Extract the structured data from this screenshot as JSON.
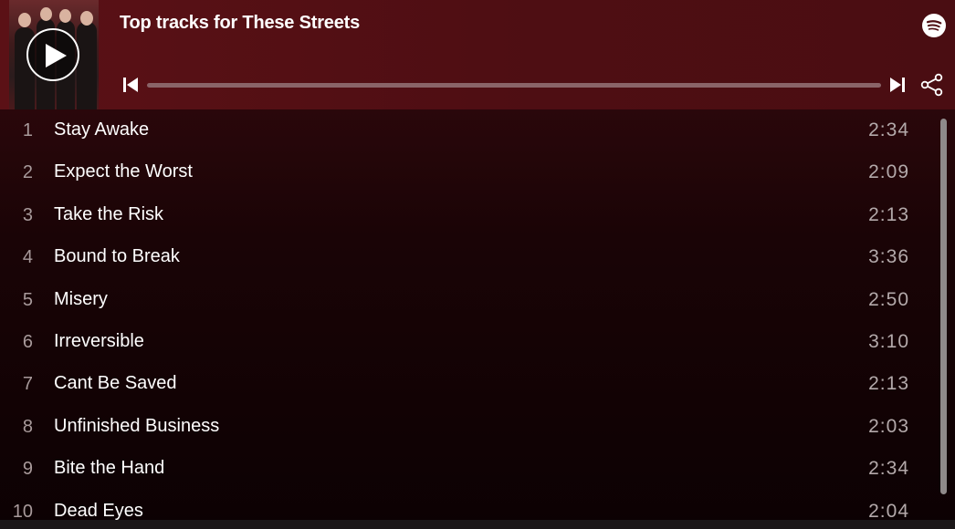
{
  "header": {
    "title": "Top tracks for These Streets",
    "colors": {
      "background": "#4f0e13",
      "text": "#ffffff"
    },
    "icons": {
      "play": "play-icon",
      "brand": "spotify-icon",
      "previous": "skip-previous-icon",
      "next": "skip-next-icon",
      "share": "share-icon"
    },
    "progress_fraction": 0
  },
  "tracks": [
    {
      "number": "1",
      "name": "Stay Awake",
      "duration": "2:34"
    },
    {
      "number": "2",
      "name": "Expect the Worst",
      "duration": "2:09"
    },
    {
      "number": "3",
      "name": "Take the Risk",
      "duration": "2:13"
    },
    {
      "number": "4",
      "name": "Bound to Break",
      "duration": "3:36"
    },
    {
      "number": "5",
      "name": "Misery",
      "duration": "2:50"
    },
    {
      "number": "6",
      "name": "Irreversible",
      "duration": "3:10"
    },
    {
      "number": "7",
      "name": "Cant Be Saved",
      "duration": "2:13"
    },
    {
      "number": "8",
      "name": "Unfinished Business",
      "duration": "2:03"
    },
    {
      "number": "9",
      "name": "Bite the Hand",
      "duration": "2:34"
    },
    {
      "number": "10",
      "name": "Dead Eyes",
      "duration": "2:04"
    }
  ]
}
